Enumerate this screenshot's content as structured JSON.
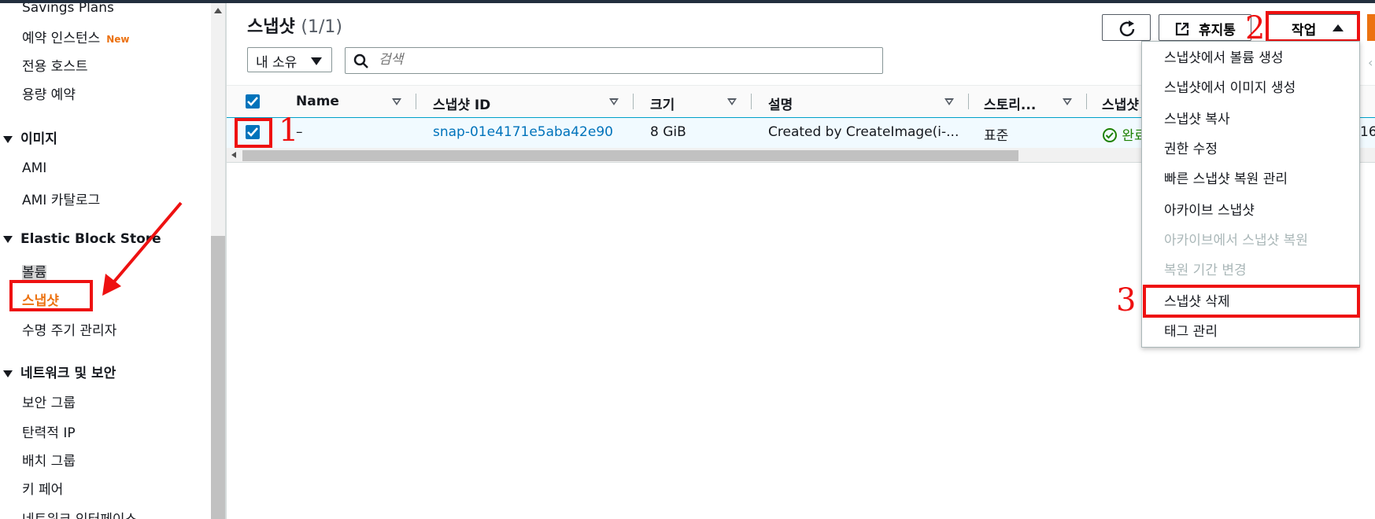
{
  "sidebar": {
    "items": {
      "savings_plans": "Savings Plans",
      "reserved": "예약 인스턴스",
      "reserved_badge": "New",
      "dedicated": "전용 호스트",
      "capacity": "용량 예약",
      "group_images": "이미지",
      "ami": "AMI",
      "ami_catalog": "AMI 카탈로그",
      "group_ebs": "Elastic Block Store",
      "volumes": "볼륨",
      "snapshots": "스냅샷",
      "lifecycle": "수명 주기 관리자",
      "group_network": "네트워크 및 보안",
      "security_groups": "보안 그룹",
      "elastic_ip": "탄력적 IP",
      "placement": "배치 그룹",
      "key_pairs": "키 페어",
      "net_interfaces": "네트워크 인터페이스"
    }
  },
  "header": {
    "title": "스냅샷",
    "count": "(1/1)"
  },
  "filter": {
    "owner_select": "내 소유",
    "search_placeholder": "검색"
  },
  "toolbar": {
    "hibernate_label": "휴지통",
    "actions_label": "작업"
  },
  "table": {
    "columns": [
      "Name",
      "스냅샷 ID",
      "크기",
      "설명",
      "스토리...",
      "스냅샷"
    ],
    "rows": [
      {
        "name": "–",
        "snapshot_id": "snap-01e4171e5aba42e90",
        "size": "8 GiB",
        "description": "Created by CreateImage(i-...",
        "storage": "표준",
        "status": "완료",
        "extra": "16"
      }
    ]
  },
  "menu": {
    "items": [
      {
        "label": "스냅샷에서 볼륨 생성",
        "disabled": false
      },
      {
        "label": "스냅샷에서 이미지 생성",
        "disabled": false
      },
      {
        "label": "스냅샷 복사",
        "disabled": false
      },
      {
        "label": "권한 수정",
        "disabled": false
      },
      {
        "label": "빠른 스냅샷 복원 관리",
        "disabled": false
      },
      {
        "label": "아카이브 스냅샷",
        "disabled": false
      },
      {
        "label": "아카이브에서 스냅샷 복원",
        "disabled": true
      },
      {
        "label": "복원 기간 변경",
        "disabled": true
      },
      {
        "label": "스냅샷 삭제",
        "disabled": false
      },
      {
        "label": "태그 관리",
        "disabled": false
      }
    ]
  },
  "annotations": {
    "step1": "1",
    "step2": "2",
    "step3": "3",
    "color": "#ee1111"
  },
  "colors": {
    "accent": "#ec7211",
    "link": "#0073bb",
    "success": "#1d8102"
  },
  "icons": [
    "refresh-icon",
    "external-link-icon",
    "search-icon",
    "check-circle-icon",
    "checkbox-checked-icon",
    "caret-down-icon",
    "caret-up-icon"
  ]
}
